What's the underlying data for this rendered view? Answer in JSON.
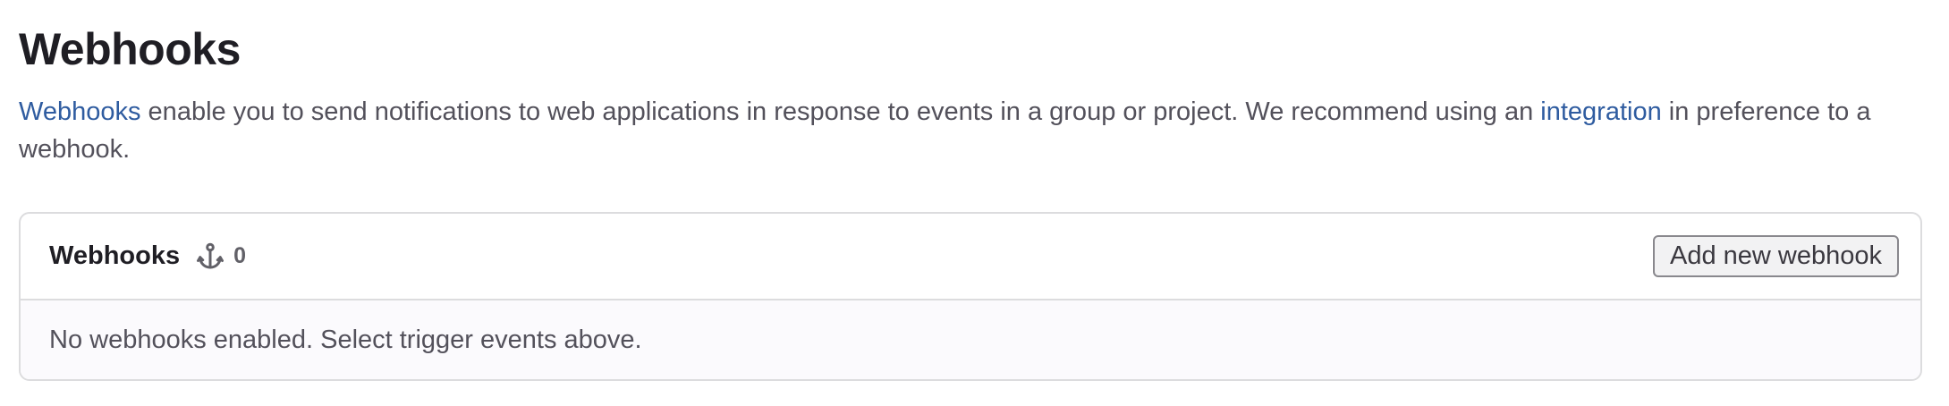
{
  "page": {
    "title": "Webhooks",
    "description": {
      "link_webhooks": "Webhooks",
      "text_part1": " enable you to send notifications to web applications in response to events in a group or project. We recommend using an ",
      "link_integration": "integration",
      "text_part2": " in preference to a webhook."
    }
  },
  "card": {
    "title": "Webhooks",
    "icon": "webhook-icon",
    "count": "0",
    "add_button_label": "Add new webhook",
    "empty_message": "No webhooks enabled. Select trigger events above."
  },
  "colors": {
    "link": "#2f5ca0",
    "border": "#dcdcde",
    "body_bg": "#fbfafd"
  }
}
